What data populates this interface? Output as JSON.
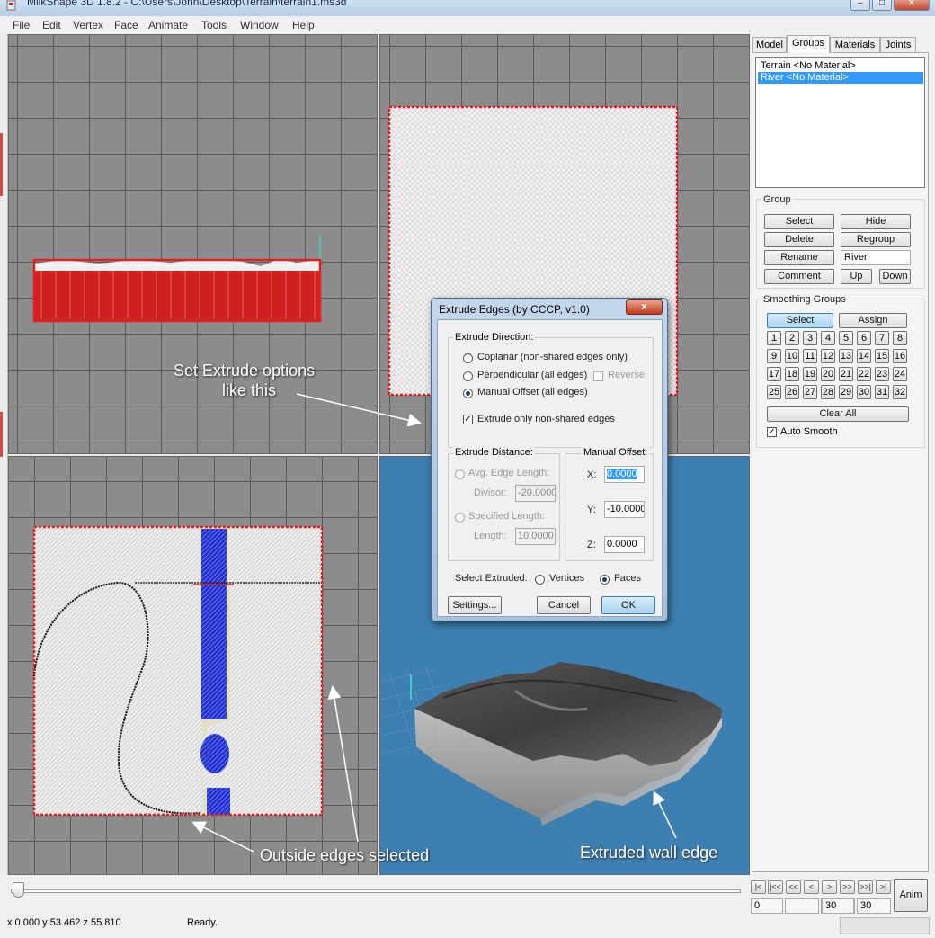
{
  "window": {
    "title": "MilkShape 3D 1.8.2 - C:\\Users\\John\\Desktop\\Terrain\\terrain1.ms3d",
    "controls": [
      "–",
      "□",
      "✕"
    ]
  },
  "menu": [
    "File",
    "Edit",
    "Vertex",
    "Face",
    "Animate",
    "Tools",
    "Window",
    "Help"
  ],
  "right_panel": {
    "tabs": [
      "Model",
      "Groups",
      "Materials",
      "Joints"
    ],
    "active_tab": "Groups",
    "groups_list": [
      {
        "label": "Terrain <No Material>",
        "selected": false
      },
      {
        "label": "River <No Material>",
        "selected": true
      }
    ],
    "group": {
      "legend": "Group",
      "select": "Select",
      "hide": "Hide",
      "delete": "Delete",
      "regroup": "Regroup",
      "rename": "Rename",
      "name_value": "River",
      "comment": "Comment",
      "up": "Up",
      "down": "Down"
    },
    "smoothing": {
      "legend": "Smoothing Groups",
      "select": "Select",
      "assign": "Assign",
      "numbers": [
        "1",
        "2",
        "3",
        "4",
        "5",
        "6",
        "7",
        "8",
        "9",
        "10",
        "11",
        "12",
        "13",
        "14",
        "15",
        "16",
        "17",
        "18",
        "19",
        "20",
        "21",
        "22",
        "23",
        "24",
        "25",
        "26",
        "27",
        "28",
        "29",
        "30",
        "31",
        "32"
      ],
      "clear_all": "Clear All",
      "auto_smooth": "Auto Smooth",
      "auto_smooth_checked": true
    }
  },
  "dialog": {
    "title": "Extrude Edges (by CCCP, v1.0)",
    "close": "x",
    "direction": {
      "legend": "Extrude Direction:",
      "coplanar": "Coplanar (non-shared edges only)",
      "perpendicular": "Perpendicular (all edges)",
      "reverse": "Reverse",
      "manual": "Manual Offset (all edges)",
      "selected": "manual",
      "only_nonshared": "Extrude only non-shared edges",
      "only_nonshared_checked": true
    },
    "distance": {
      "legend": "Extrude Distance:",
      "avg": "Avg. Edge Length:",
      "divisor_label": "Divisor:",
      "divisor_value": "-20.0000",
      "specified": "Specified Length:",
      "length_label": "Length:",
      "length_value": "10.0000"
    },
    "offset": {
      "legend": "Manual Offset:",
      "x_label": "X:",
      "x_value": "0.0000",
      "y_label": "Y:",
      "y_value": "-10.0000",
      "z_label": "Z:",
      "z_value": "0.0000"
    },
    "select_extruded": {
      "label": "Select Extruded:",
      "vertices": "Vertices",
      "faces": "Faces",
      "selected": "faces"
    },
    "settings": "Settings...",
    "cancel": "Cancel",
    "ok": "OK"
  },
  "annotations": {
    "extrude_line1": "Set Extrude options",
    "extrude_line2": "like this",
    "outside_edges": "Outside edges selected",
    "extruded_wall": "Extruded wall edge"
  },
  "animation": {
    "buttons": [
      "|<",
      "|<<",
      "<<",
      "<",
      ">",
      ">>",
      ">>|",
      ">|"
    ],
    "frame": "0",
    "start": "30",
    "end": "30",
    "anim": "Anim",
    "slider_position": 0
  },
  "status": {
    "coords": "x 0.000 y 53.462 z 55.810",
    "message": "Ready."
  },
  "colors": {
    "selected_edge": "#e02020",
    "river": "#2230c8",
    "viewport_grid": "#8c8c8c",
    "perspective_bg": "#3c7fb0"
  }
}
